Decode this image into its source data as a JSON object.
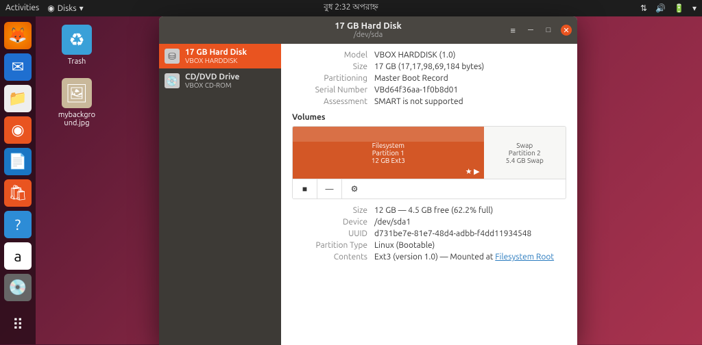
{
  "topbar": {
    "activities": "Activities",
    "app_name": "Disks",
    "clock": "বুধ  2:32 অপরাহ্ন"
  },
  "desktop_icons": {
    "trash": "Trash",
    "file": "mybackgro\nund.jpg"
  },
  "window": {
    "title": "17 GB Hard Disk",
    "subtitle": "/dev/sda"
  },
  "sidebar": [
    {
      "line1": "17 GB Hard Disk",
      "line2": "VBOX HARDDISK"
    },
    {
      "line1": "CD/DVD Drive",
      "line2": "VBOX CD-ROM"
    }
  ],
  "disk_info": {
    "model_k": "Model",
    "model_v": "VBOX HARDDISK (1.0)",
    "size_k": "Size",
    "size_v": "17 GB (17,17,98,69,184 bytes)",
    "part_k": "Partitioning",
    "part_v": "Master Boot Record",
    "serial_k": "Serial Number",
    "serial_v": "VBd64f36aa-1f0b8d01",
    "assess_k": "Assessment",
    "assess_v": "SMART is not supported"
  },
  "volumes_label": "Volumes",
  "volumes": {
    "p1": {
      "name": "Filesystem",
      "sub": "Partition 1",
      "size": "12 GB Ext3"
    },
    "p2": {
      "name": "Swap",
      "sub": "Partition 2",
      "size": "5.4 GB Swap"
    }
  },
  "partition_info": {
    "size_k": "Size",
    "size_v": "12 GB — 4.5 GB free (62.2% full)",
    "device_k": "Device",
    "device_v": "/dev/sda1",
    "uuid_k": "UUID",
    "uuid_v": "d731be7e-81e7-48d4-adbb-f4dd11934548",
    "ptype_k": "Partition Type",
    "ptype_v": "Linux (Bootable)",
    "contents_k": "Contents",
    "contents_v_pre": "Ext3 (version 1.0) — Mounted at ",
    "contents_link": "Filesystem Root"
  }
}
